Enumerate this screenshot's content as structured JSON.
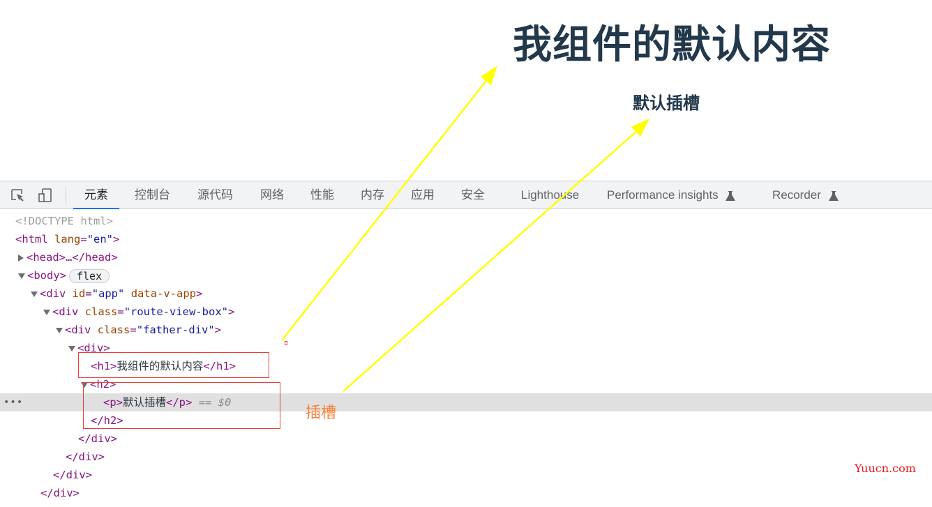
{
  "preview": {
    "heading1": "我组件的默认内容",
    "heading2": "默认插槽"
  },
  "toolbar": {
    "icons": [
      "inspect-element-icon",
      "device-toolbar-icon"
    ],
    "tabs": [
      {
        "label": "元素",
        "active": true
      },
      {
        "label": "控制台"
      },
      {
        "label": "源代码"
      },
      {
        "label": "网络"
      },
      {
        "label": "性能"
      },
      {
        "label": "内存"
      },
      {
        "label": "应用"
      },
      {
        "label": "安全"
      },
      {
        "label": "Lighthouse"
      },
      {
        "label": "Performance insights",
        "icon": "flask-icon"
      },
      {
        "label": "Recorder",
        "icon": "flask-icon"
      }
    ]
  },
  "tree": {
    "doctype": "<!DOCTYPE html>",
    "html_open_tag": "<html",
    "html_attr": "lang",
    "html_attr_val": "\"en\"",
    "html_close": ">",
    "head": "<head>…</head>",
    "body_open": "<body>",
    "body_badge": "flex",
    "app_tag": "<div",
    "app_attr_id": "id",
    "app_attr_id_val": "\"app\"",
    "app_attr_data": "data-v-app",
    "app_close": ">",
    "route_tag": "<div",
    "route_attr": "class",
    "route_val": "\"route-view-box\"",
    "route_close": ">",
    "father_tag": "<div",
    "father_attr": "class",
    "father_val": "\"father-div\"",
    "father_close": ">",
    "div_open": "<div>",
    "h1_open": "<h1>",
    "h1_text": "我组件的默认内容",
    "h1_close": "</h1>",
    "h2_open": "<h2>",
    "p_open": "<p>",
    "p_text": "默认插槽",
    "p_close": "</p>",
    "selected_marker": "== $0",
    "row_menu": "•••",
    "h2_close": "</h2>",
    "div_close": "</div>"
  },
  "annotations": {
    "slot_label": "插槽",
    "watermark": "Yuucn.com",
    "arrow_color": "#ffff00",
    "box_color": "#e8403a"
  }
}
